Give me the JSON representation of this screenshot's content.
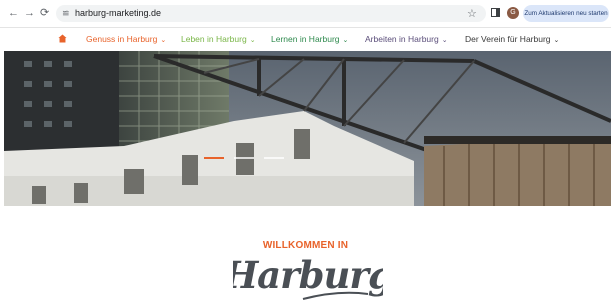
{
  "browser": {
    "url": "harburg-marketing.de",
    "profile_initial": "G",
    "update_button": "Zum Aktualisieren neu starten",
    "icons": [
      "back-icon",
      "forward-icon",
      "reload-icon",
      "site-info-icon",
      "bookmark-star-icon",
      "side-panel-icon"
    ]
  },
  "nav": {
    "items": [
      {
        "label": "Genuss in Harburg",
        "color": "#e8632b"
      },
      {
        "label": "Leben in Harburg",
        "color": "#7ab648"
      },
      {
        "label": "Lernen in Harburg",
        "color": "#2f8a4e"
      },
      {
        "label": "Arbeiten in Harburg",
        "color": "#5b4e7a"
      },
      {
        "label": "Der Verein für Harburg",
        "color": "#3a3a3a"
      }
    ],
    "home_icon_color": "#e8632b"
  },
  "hero": {
    "slides_total": 3,
    "active_slide": 1,
    "active_color": "#e8632b"
  },
  "welcome": {
    "heading": "WILLKOMMEN IN",
    "brand": "Harburg"
  }
}
